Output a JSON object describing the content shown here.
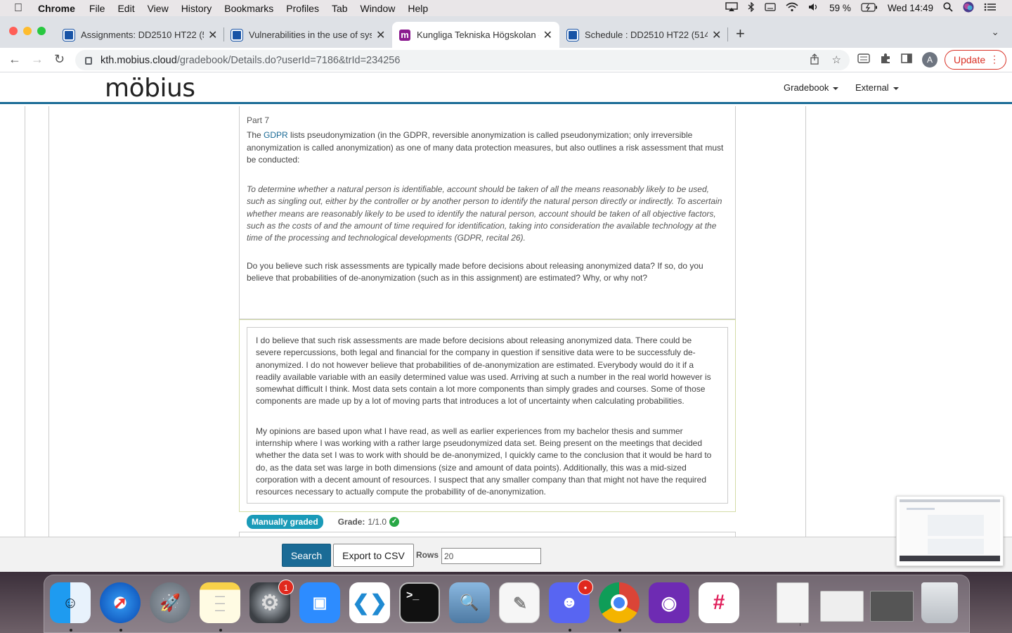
{
  "menubar": {
    "app": "Chrome",
    "items": [
      "File",
      "Edit",
      "View",
      "History",
      "Bookmarks",
      "Profiles",
      "Tab",
      "Window",
      "Help"
    ],
    "battery": "59 %",
    "clock": "Wed 14:49"
  },
  "tabs": [
    {
      "title": "Assignments: DD2510 HT22 (5",
      "active": false
    },
    {
      "title": "Vulnerabilities in the use of sys",
      "active": false
    },
    {
      "title": "Kungliga Tekniska Högskolan -",
      "active": true
    },
    {
      "title": "Schedule : DD2510 HT22 (514",
      "active": false
    }
  ],
  "address": {
    "domain": "kth.mobius.cloud",
    "path": "/gradebook/Details.do?userId=7186&trId=234256"
  },
  "toolbar": {
    "avatar_letter": "A",
    "update_label": "Update"
  },
  "site": {
    "logo": "möbius",
    "nav": [
      "Gradebook",
      "External"
    ]
  },
  "question": {
    "part": "Part 7",
    "intro_pre": "The ",
    "link": "GDPR",
    "intro_post": " lists pseudonymization (in the GDPR, reversible anonymization is called pseudonymization; only irreversible anonymization is called anonymization) as one of many data protection measures, but also outlines a risk assessment that must be conducted:",
    "quote": "To determine whether a natural person is identifiable, account should be taken of all the means reasonably likely to be used, such as singling out, either by the controller or by another person to identify the natural person directly or indirectly. To ascertain whether means are reasonably likely to be used to identify the natural person, account should be taken of all objective factors, such as the costs of and the amount of time required for identification, taking into consideration the available technology at the time of the processing and technological developments (GDPR, recital 26).",
    "prompt": "Do you believe such risk assessments are typically made before decisions about releasing anonymized data? If so, do you believe that probabilities of de-anonymization (such as in this assignment) are estimated? Why, or why not?"
  },
  "answer": {
    "p1": "I do believe that such risk assessments are made before decisions about releasing anonymized data. There could be severe repercussions, both legal and financial for the company in question if sensitive data were to be successfuly de-anonymized. I do not however believe that probabilities of de-anonymization are estimated. Everybody would do it if a readily available variable with an easily determined value was used. Arriving at such a number in the real world however is somewhat difficult I think. Most data sets contain a lot more components than simply grades and courses. Some of those components are made up by a lot of moving parts that introduces a lot of uncertainty when calculating probabilities.",
    "p2": "My opinions are based upon what I have read, as well as earlier experiences from my bachelor thesis and summer internship where I was working with a rather large  pseudonymized data set. Being present on the meetings that decided whether the data set I was to work with should be de-anonymized, I quickly came to the conclusion that it would be hard to do, as the data set was large in both dimensions (size and amount of data points). Additionally, this was a mid-sized corporation with a decent amount of resources. I suspect that any smaller company than that might not have the required resources necessary to actually compute the probabillity of de-anonymization."
  },
  "grading": {
    "badge": "Manually graded",
    "grade_label": "Grade:",
    "grade_value": "1/1.0"
  },
  "bottom": {
    "search_label": "Search",
    "export_label": "Export to CSV",
    "rows_label": "Rows",
    "rows_value": "20"
  },
  "dock": {
    "badges": {
      "settings": "1"
    },
    "apps": [
      "finder",
      "safari",
      "launchpad",
      "notes",
      "system-preferences",
      "zoom",
      "vscode",
      "terminal",
      "preview",
      "textedit",
      "discord",
      "chrome",
      "github-desktop",
      "slack"
    ]
  }
}
